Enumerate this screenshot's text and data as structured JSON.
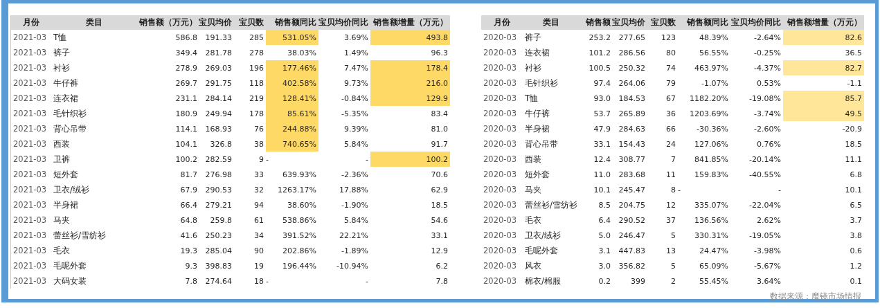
{
  "tables": [
    {
      "columns": [
        "月份",
        "类目",
        "销售额（万元）",
        "宝贝均价",
        "宝贝数",
        "销售额同比",
        "宝贝均价同比",
        "销售额增量（万元）"
      ],
      "rows": [
        {
          "month": "2021-03",
          "category": "T恤",
          "sales": "586.8",
          "price": "191.33",
          "count": "285",
          "yoy": "531.05%",
          "price_yoy": "3.69%",
          "increment": "493.8",
          "yoy_highlight": true,
          "increment_highlight": true
        },
        {
          "month": "2021-03",
          "category": "裤子",
          "sales": "349.4",
          "price": "281.78",
          "count": "278",
          "yoy": "38.03%",
          "price_yoy": "1.49%",
          "increment": "96.3",
          "yoy_highlight": false,
          "increment_highlight": false
        },
        {
          "month": "2021-03",
          "category": "衬衫",
          "sales": "278.9",
          "price": "269.03",
          "count": "196",
          "yoy": "177.46%",
          "price_yoy": "7.47%",
          "increment": "178.4",
          "yoy_highlight": true,
          "increment_highlight": true
        },
        {
          "month": "2021-03",
          "category": "牛仔裤",
          "sales": "269.7",
          "price": "291.75",
          "count": "118",
          "yoy": "402.58%",
          "price_yoy": "9.73%",
          "increment": "216.0",
          "yoy_highlight": true,
          "increment_highlight": true
        },
        {
          "month": "2021-03",
          "category": "连衣裙",
          "sales": "231.1",
          "price": "284.14",
          "count": "219",
          "yoy": "128.41%",
          "price_yoy": "-0.84%",
          "increment": "129.9",
          "yoy_highlight": true,
          "increment_highlight": true
        },
        {
          "month": "2021-03",
          "category": "毛针织衫",
          "sales": "180.9",
          "price": "249.94",
          "count": "178",
          "yoy": "85.61%",
          "price_yoy": "-5.35%",
          "increment": "83.4",
          "yoy_highlight": true,
          "increment_highlight": false
        },
        {
          "month": "2021-03",
          "category": "背心吊带",
          "sales": "114.1",
          "price": "168.93",
          "count": "76",
          "yoy": "244.88%",
          "price_yoy": "9.39%",
          "increment": "81.0",
          "yoy_highlight": true,
          "increment_highlight": false
        },
        {
          "month": "2021-03",
          "category": "西装",
          "sales": "104.1",
          "price": "326.8",
          "count": "38",
          "yoy": "740.65%",
          "price_yoy": "5.84%",
          "increment": "91.7",
          "yoy_highlight": true,
          "increment_highlight": false
        },
        {
          "month": "2021-03",
          "category": "卫裤",
          "sales": "100.2",
          "price": "282.59",
          "count": "9",
          "yoy": "-",
          "price_yoy": "-",
          "increment": "100.2",
          "yoy_highlight": false,
          "increment_highlight": true
        },
        {
          "month": "2021-03",
          "category": "短外套",
          "sales": "81.7",
          "price": "276.98",
          "count": "33",
          "yoy": "639.93%",
          "price_yoy": "-2.36%",
          "increment": "70.6",
          "yoy_highlight": false,
          "increment_highlight": false
        },
        {
          "month": "2021-03",
          "category": "卫衣/绒衫",
          "sales": "67.9",
          "price": "290.53",
          "count": "32",
          "yoy": "1263.17%",
          "price_yoy": "17.88%",
          "increment": "62.9",
          "yoy_highlight": false,
          "increment_highlight": false
        },
        {
          "month": "2021-03",
          "category": "半身裙",
          "sales": "66.4",
          "price": "279.21",
          "count": "94",
          "yoy": "38.60%",
          "price_yoy": "-1.90%",
          "increment": "18.5",
          "yoy_highlight": false,
          "increment_highlight": false
        },
        {
          "month": "2021-03",
          "category": "马夹",
          "sales": "64.8",
          "price": "259.8",
          "count": "61",
          "yoy": "538.86%",
          "price_yoy": "5.84%",
          "increment": "54.6",
          "yoy_highlight": false,
          "increment_highlight": false
        },
        {
          "month": "2021-03",
          "category": "蕾丝衫/雪纺衫",
          "sales": "41.6",
          "price": "250.23",
          "count": "34",
          "yoy": "391.52%",
          "price_yoy": "22.21%",
          "increment": "33.1",
          "yoy_highlight": false,
          "increment_highlight": false
        },
        {
          "month": "2021-03",
          "category": "毛衣",
          "sales": "19.3",
          "price": "285.04",
          "count": "90",
          "yoy": "202.86%",
          "price_yoy": "-1.89%",
          "increment": "12.9",
          "yoy_highlight": false,
          "increment_highlight": false
        },
        {
          "month": "2021-03",
          "category": "毛呢外套",
          "sales": "9.3",
          "price": "398.83",
          "count": "19",
          "yoy": "196.44%",
          "price_yoy": "-10.94%",
          "increment": "6.2",
          "yoy_highlight": false,
          "increment_highlight": false
        },
        {
          "month": "2021-03",
          "category": "大码女装",
          "sales": "7.8",
          "price": "274.64",
          "count": "18",
          "yoy": "-",
          "price_yoy": "-",
          "increment": "7.8",
          "yoy_highlight": false,
          "increment_highlight": false
        }
      ]
    },
    {
      "columns": [
        "月份",
        "类目",
        "销售额",
        "宝贝均价",
        "宝贝数",
        "销售额同比",
        "宝贝均价同比",
        "销售额增量（万元）"
      ],
      "rows": [
        {
          "month": "2020-03",
          "category": "裤子",
          "sales": "253.2",
          "price": "277.65",
          "count": "123",
          "yoy": "48.39%",
          "price_yoy": "-2.64%",
          "increment": "82.6",
          "yoy_highlight": false,
          "increment_highlight": true
        },
        {
          "month": "2020-03",
          "category": "连衣裙",
          "sales": "101.2",
          "price": "286.56",
          "count": "80",
          "yoy": "56.55%",
          "price_yoy": "-0.25%",
          "increment": "36.5",
          "yoy_highlight": false,
          "increment_highlight": false
        },
        {
          "month": "2020-03",
          "category": "衬衫",
          "sales": "100.5",
          "price": "250.32",
          "count": "74",
          "yoy": "463.97%",
          "price_yoy": "-4.37%",
          "increment": "82.7",
          "yoy_highlight": false,
          "increment_highlight": true
        },
        {
          "month": "2020-03",
          "category": "毛针织衫",
          "sales": "97.4",
          "price": "264.06",
          "count": "79",
          "yoy": "-1.07%",
          "price_yoy": "0.53%",
          "increment": "-1.1",
          "yoy_highlight": false,
          "increment_highlight": false
        },
        {
          "month": "2020-03",
          "category": "T恤",
          "sales": "93.0",
          "price": "184.53",
          "count": "67",
          "yoy": "1182.20%",
          "price_yoy": "-19.08%",
          "increment": "85.7",
          "yoy_highlight": false,
          "increment_highlight": true
        },
        {
          "month": "2020-03",
          "category": "牛仔裤",
          "sales": "53.7",
          "price": "265.89",
          "count": "36",
          "yoy": "1203.69%",
          "price_yoy": "-3.74%",
          "increment": "49.5",
          "yoy_highlight": false,
          "increment_highlight": true
        },
        {
          "month": "2020-03",
          "category": "半身裙",
          "sales": "47.9",
          "price": "284.63",
          "count": "66",
          "yoy": "-30.36%",
          "price_yoy": "-2.60%",
          "increment": "-20.9",
          "yoy_highlight": false,
          "increment_highlight": false
        },
        {
          "month": "2020-03",
          "category": "背心吊带",
          "sales": "33.1",
          "price": "154.43",
          "count": "24",
          "yoy": "127.06%",
          "price_yoy": "0.76%",
          "increment": "18.5",
          "yoy_highlight": false,
          "increment_highlight": false
        },
        {
          "month": "2020-03",
          "category": "西装",
          "sales": "12.4",
          "price": "308.77",
          "count": "7",
          "yoy": "841.85%",
          "price_yoy": "-20.14%",
          "increment": "11.1",
          "yoy_highlight": false,
          "increment_highlight": false
        },
        {
          "month": "2020-03",
          "category": "短外套",
          "sales": "11.0",
          "price": "283.68",
          "count": "11",
          "yoy": "159.83%",
          "price_yoy": "-40.55%",
          "increment": "6.8",
          "yoy_highlight": false,
          "increment_highlight": false
        },
        {
          "month": "2020-03",
          "category": "马夹",
          "sales": "10.1",
          "price": "245.47",
          "count": "8",
          "yoy": "-",
          "price_yoy": "-",
          "increment": "10.1",
          "yoy_highlight": false,
          "increment_highlight": false
        },
        {
          "month": "2020-03",
          "category": "蕾丝衫/雪纺衫",
          "sales": "8.5",
          "price": "204.75",
          "count": "12",
          "yoy": "335.07%",
          "price_yoy": "-22.04%",
          "increment": "6.5",
          "yoy_highlight": false,
          "increment_highlight": false
        },
        {
          "month": "2020-03",
          "category": "毛衣",
          "sales": "6.4",
          "price": "290.52",
          "count": "37",
          "yoy": "136.56%",
          "price_yoy": "2.62%",
          "increment": "3.7",
          "yoy_highlight": false,
          "increment_highlight": false
        },
        {
          "month": "2020-03",
          "category": "卫衣/绒衫",
          "sales": "5.0",
          "price": "246.47",
          "count": "5",
          "yoy": "330.31%",
          "price_yoy": "-19.05%",
          "increment": "3.8",
          "yoy_highlight": false,
          "increment_highlight": false
        },
        {
          "month": "2020-03",
          "category": "毛呢外套",
          "sales": "3.1",
          "price": "447.83",
          "count": "13",
          "yoy": "24.47%",
          "price_yoy": "-3.98%",
          "increment": "0.6",
          "yoy_highlight": false,
          "increment_highlight": false
        },
        {
          "month": "2020-03",
          "category": "风衣",
          "sales": "3.0",
          "price": "356.82",
          "count": "5",
          "yoy": "65.09%",
          "price_yoy": "-5.67%",
          "increment": "1.2",
          "yoy_highlight": false,
          "increment_highlight": false
        },
        {
          "month": "2020-03",
          "category": "棉衣/棉服",
          "sales": "0.2",
          "price": "399",
          "count": "2",
          "yoy": "55.45%",
          "price_yoy": "3.64%",
          "increment": "0.1",
          "yoy_highlight": false,
          "increment_highlight": false
        }
      ]
    }
  ],
  "source": "数据来源：魔镜市场情报"
}
